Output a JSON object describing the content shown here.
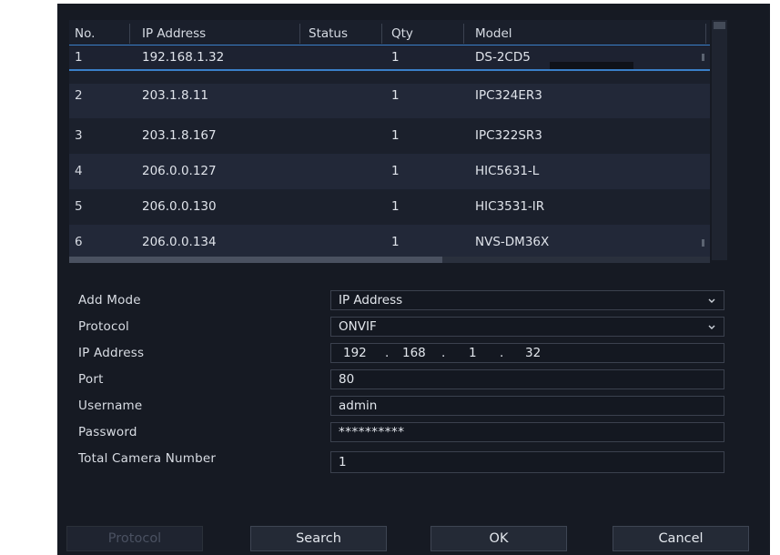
{
  "table": {
    "columns": [
      "No.",
      "IP Address",
      "Status",
      "Qty",
      "Model"
    ],
    "rows": [
      {
        "no": "1",
        "ip": "192.168.1.32",
        "status": "",
        "qty": "1",
        "model": "DS-2CD5"
      },
      {
        "no": "2",
        "ip": "203.1.8.11",
        "status": "",
        "qty": "1",
        "model": "IPC324ER3"
      },
      {
        "no": "3",
        "ip": "203.1.8.167",
        "status": "",
        "qty": "1",
        "model": "IPC322SR3"
      },
      {
        "no": "4",
        "ip": "206.0.0.127",
        "status": "",
        "qty": "1",
        "model": "HIC5631-L"
      },
      {
        "no": "5",
        "ip": "206.0.0.130",
        "status": "",
        "qty": "1",
        "model": "HIC3531-IR"
      },
      {
        "no": "6",
        "ip": "206.0.0.134",
        "status": "",
        "qty": "1",
        "model": "NVS-DM36X"
      }
    ]
  },
  "form": {
    "add_mode": {
      "label": "Add Mode",
      "value": "IP Address"
    },
    "protocol": {
      "label": "Protocol",
      "value": "ONVIF"
    },
    "ip_address": {
      "label": "IP Address",
      "octets": [
        "192",
        "168",
        "1",
        "32"
      ],
      "separator": "."
    },
    "port": {
      "label": "Port",
      "value": "80"
    },
    "username": {
      "label": "Username",
      "value": "admin"
    },
    "password": {
      "label": "Password",
      "value": "**********"
    },
    "total_camera_number": {
      "label": "Total Camera Number",
      "value": "1"
    }
  },
  "buttons": {
    "protocol": "Protocol",
    "search": "Search",
    "ok": "OK",
    "cancel": "Cancel"
  },
  "icons": {
    "dropdown": "chevron-down-icon"
  },
  "colors": {
    "dialog_bg": "#161a23",
    "accent": "#3a7fc8",
    "row_alt": "#222838"
  }
}
